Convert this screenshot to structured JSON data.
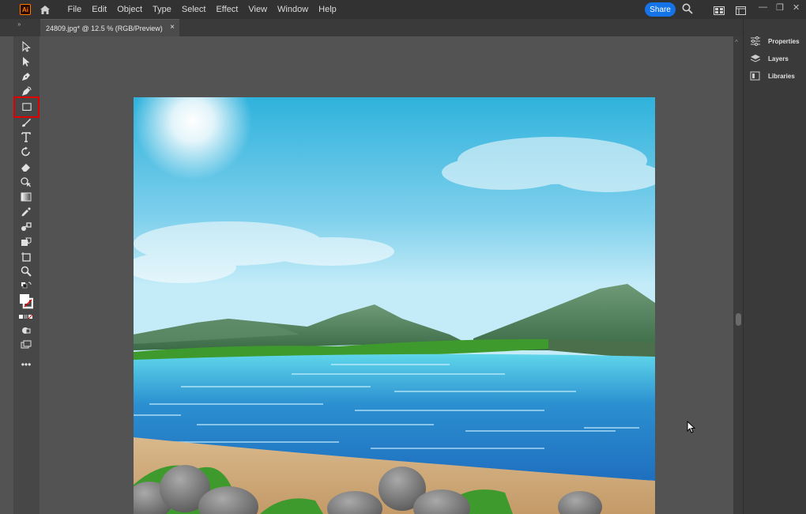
{
  "app": {
    "logo_text": "Ai"
  },
  "menu": [
    "File",
    "Edit",
    "Object",
    "Type",
    "Select",
    "Effect",
    "View",
    "Window",
    "Help"
  ],
  "share_label": "Share",
  "document_tab": {
    "label": "24809.jpg* @ 12.5 % (RGB/Preview)",
    "close": "×"
  },
  "right_panel": {
    "items": [
      "Properties",
      "Layers",
      "Libraries"
    ]
  },
  "window_controls": {
    "minimize": "—",
    "restore": "❐",
    "close": "✕"
  },
  "tools": [
    "selection-tool",
    "direct-selection-tool",
    "pen-tool",
    "curvature-tool",
    "rectangle-tool",
    "paintbrush-tool",
    "type-tool",
    "rotate-tool",
    "eraser-tool",
    "shape-builder-tool",
    "gradient-tool",
    "eyedropper-tool",
    "blend-tool",
    "live-paint-tool",
    "artboard-tool",
    "zoom-tool"
  ],
  "colors": {
    "accent": "#1473e6",
    "highlight": "#e00000"
  }
}
